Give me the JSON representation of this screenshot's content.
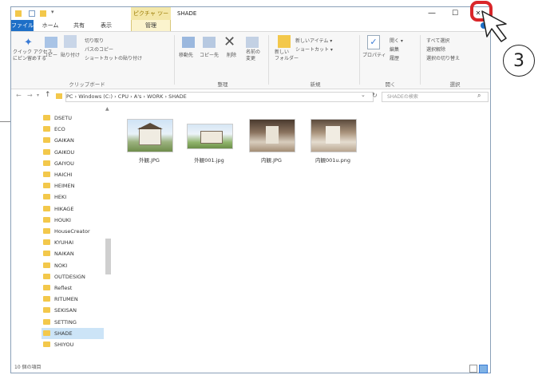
{
  "window": {
    "title": "SHADE",
    "context_tab": "ピクチャ ツール",
    "minimize": "—",
    "maximize": "☐",
    "close": "✕"
  },
  "tabs": [
    "ファイル",
    "ホーム",
    "共有",
    "表示",
    "管理"
  ],
  "ribbon": {
    "clipboard": {
      "pin_label": "クイック アクセス\nにピン留めする",
      "copy": "コピー",
      "paste": "貼り付け",
      "cut": "切り取り",
      "copy_path": "パスのコピー",
      "paste_shortcut": "ショートカットの貼り付け",
      "group": "クリップボード"
    },
    "organize": {
      "move_to": "移動先",
      "copy_to": "コピー先",
      "delete": "削除",
      "rename": "名前の\n変更",
      "group": "整理"
    },
    "new": {
      "new_folder": "新しい\nフォルダー",
      "new_item": "新しいアイテム ▾",
      "shortcut": "ショートカット ▾",
      "group": "新規"
    },
    "open": {
      "properties": "プロパティ",
      "open": "開く ▾",
      "edit": "編集",
      "history": "履歴",
      "group": "開く"
    },
    "select": {
      "select_all": "すべて選択",
      "select_none": "選択解除",
      "invert": "選択の切り替え",
      "group": "選択"
    }
  },
  "address": {
    "path": "PC  ›  Windows (C:)  ›  CPU  ›  A's  ›  WORK  ›  SHADE",
    "search_placeholder": "SHADEの検索"
  },
  "nav": [
    "DSETU",
    "ECO",
    "GAIKAN",
    "GAIKOU",
    "GAIYOU",
    "HAICHI",
    "HEIMEN",
    "HEKI",
    "HIKAGE",
    "HOUKI",
    "HouseCreator",
    "KYUHAI",
    "NAIKAN",
    "NOKI",
    "OUTDESIGN",
    "Reflest",
    "RITUMEN",
    "SEKISAN",
    "SETTING",
    "SHADE",
    "SHIYOU"
  ],
  "files": [
    "外観.JPG",
    "外観001.jpg",
    "内観.JPG",
    "内観001u.png"
  ],
  "status": "10 個の項目",
  "annotation": {
    "step": "3"
  },
  "colors": {
    "accent": "#1e6fc7",
    "folder": "#f3c84b",
    "highlight": "#d9262a"
  }
}
